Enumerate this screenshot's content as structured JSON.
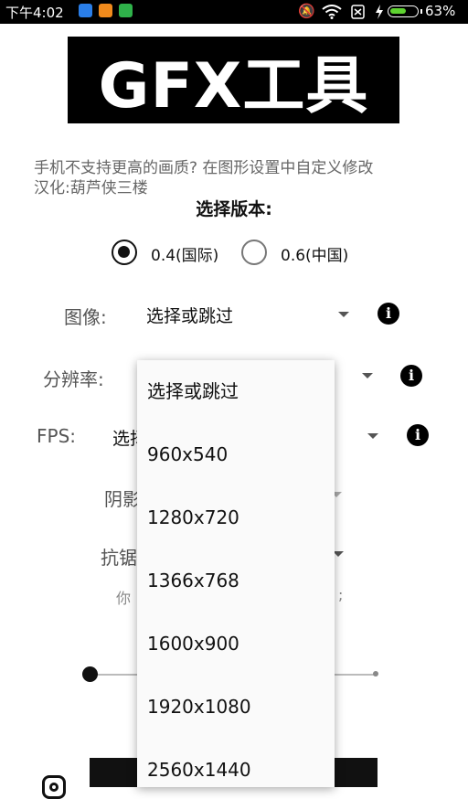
{
  "status_bar": {
    "time": "下午4:02",
    "battery_percent": "63%",
    "battery_level": 0.63,
    "icons": [
      "shield-app-icon",
      "orange-app-icon",
      "green-app-icon",
      "bell-muted-icon",
      "wifi-icon",
      "sim-off-icon",
      "charging-icon",
      "battery-icon"
    ]
  },
  "banner": {
    "title": "GFX工具"
  },
  "hints": {
    "line1": "手机不支持更高的画质? 在图形设置中自定义修改",
    "line2": "汉化:葫芦侠三楼"
  },
  "version": {
    "title": "选择版本:",
    "options": [
      {
        "label": "0.4(国际)",
        "selected": true
      },
      {
        "label": "0.6(中国)",
        "selected": false
      }
    ]
  },
  "settings": {
    "graphics": {
      "label": "图像:",
      "value": "选择或跳过"
    },
    "resolution": {
      "label": "分辨率:"
    },
    "fps": {
      "label": "FPS:",
      "value_partial": "选择"
    },
    "shadow": {
      "label_partial": "阴影"
    },
    "antialias": {
      "label_partial": "抗锯"
    },
    "note_left": "你",
    "note_right": ";"
  },
  "dropdown": {
    "options": [
      "选择或跳过",
      "960x540",
      "1280x720",
      "1366x768",
      "1600x900",
      "1920x1080",
      "2560x1440"
    ]
  },
  "colors": {
    "battery_fill": "#5ed330",
    "status_bar_bg": "#000000",
    "banner_bg": "#000000"
  }
}
